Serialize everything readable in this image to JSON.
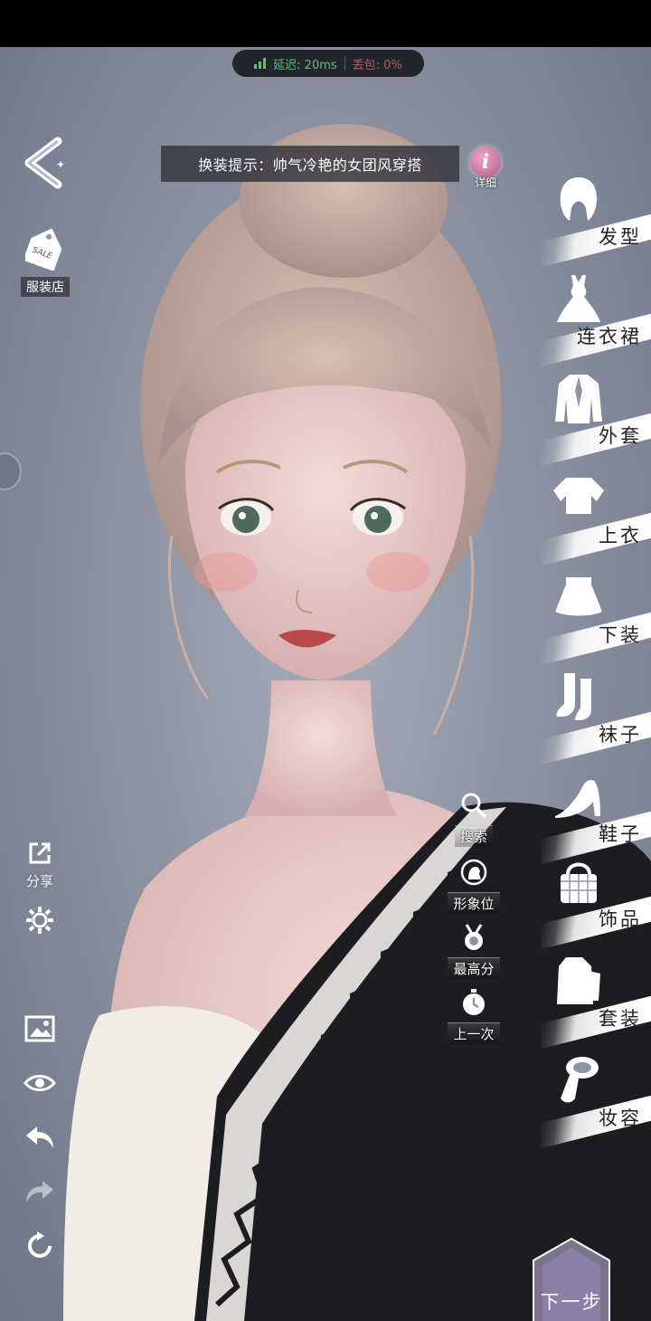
{
  "status": {
    "latency": "延迟: 20ms",
    "packet_loss": "丢包: 0%"
  },
  "hint": {
    "text": "换装提示：帅气冷艳的女团风穿搭",
    "info_label": "详细"
  },
  "left": {
    "shop_label": "服装店",
    "share_label": "分享"
  },
  "categories": [
    {
      "label": "发型",
      "icon": "hair-icon"
    },
    {
      "label": "连衣裙",
      "icon": "dress-icon"
    },
    {
      "label": "外套",
      "icon": "coat-icon"
    },
    {
      "label": "上衣",
      "icon": "top-icon"
    },
    {
      "label": "下装",
      "icon": "skirt-icon"
    },
    {
      "label": "袜子",
      "icon": "socks-icon"
    },
    {
      "label": "鞋子",
      "icon": "shoe-icon"
    },
    {
      "label": "饰品",
      "icon": "bag-icon"
    },
    {
      "label": "套装",
      "icon": "suit-icon"
    },
    {
      "label": "妆容",
      "icon": "makeup-icon"
    }
  ],
  "quick": [
    {
      "label": "搜索",
      "icon": "search-icon"
    },
    {
      "label": "形象位",
      "icon": "portrait-slot-icon"
    },
    {
      "label": "最高分",
      "icon": "medal-icon"
    },
    {
      "label": "上一次",
      "icon": "clock-icon"
    }
  ],
  "next_label": "下一步",
  "colors": {
    "signal": "#63c073",
    "loss": "#b45c5c",
    "background": "#8f95a4"
  }
}
